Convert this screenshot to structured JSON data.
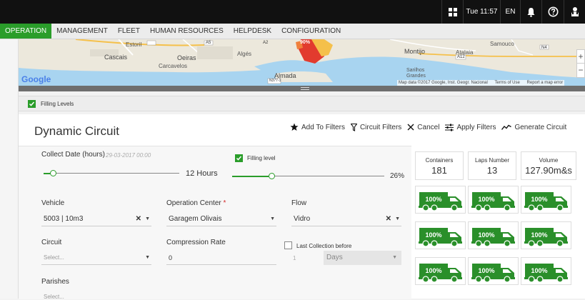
{
  "topbar": {
    "time": "Tue 11:57",
    "lang": "EN"
  },
  "nav": [
    {
      "label": "OPERATION"
    },
    {
      "label": "MANAGEMENT"
    },
    {
      "label": "FLEET"
    },
    {
      "label": "HUMAN RESOURCES"
    },
    {
      "label": "HELPDESK"
    },
    {
      "label": "CONFIGURATION"
    }
  ],
  "map": {
    "places": [
      "Estoril",
      "Cascais",
      "Oeiras",
      "Carcavelos",
      "Algés",
      "Almada",
      "Montijo",
      "Atalaia",
      "Samouco",
      "Sarilhos Grandes"
    ],
    "roads": [
      "A5",
      "A2",
      "A12",
      "N4",
      "N377-1"
    ],
    "google": "Google",
    "attribution": "Map data ©2017 Google, Inst. Geogr. Nacional",
    "terms": "Terms of Use",
    "report": "Report a map error",
    "marker": "90%",
    "zoom_in": "+",
    "zoom_out": "−"
  },
  "filling_bar": {
    "label": "Filling Levels",
    "checked": true
  },
  "main": {
    "title": "Dynamic Circuit",
    "toolbar": {
      "add_filters": "Add To Filters",
      "circuit_filters": "Circuit Filters",
      "cancel": "Cancel",
      "apply_filters": "Apply Filters",
      "generate_circuit": "Generate Circuit"
    },
    "collect_date": {
      "label": "Collect Date (hours)",
      "hint": "29-03-2017 00:00",
      "value": "12 Hours",
      "fraction": 0.08
    },
    "filling_level": {
      "label": "Filling level",
      "value": "26%",
      "fraction": 0.26,
      "checked": true
    },
    "vehicle": {
      "label": "Vehicle",
      "value": "5003 | 10m3"
    },
    "operation_center": {
      "label": "Operation Center",
      "required": "*",
      "value": "Garagem Olivais"
    },
    "flow": {
      "label": "Flow",
      "value": "Vidro"
    },
    "circuit": {
      "label": "Circuit",
      "placeholder": "Select..."
    },
    "compression_rate": {
      "label": "Compression Rate",
      "value": "0"
    },
    "last_collection": {
      "label": "Last Collection before",
      "number": "1",
      "unit": "Days",
      "checked": false
    },
    "parishes": {
      "label": "Parishes",
      "placeholder": "Select..."
    }
  },
  "stats": [
    {
      "title": "Containers",
      "value": "181"
    },
    {
      "title": "Laps Number",
      "value": "13"
    },
    {
      "title": "Volume",
      "value": "127.90m&s"
    }
  ],
  "trucks": [
    "100%",
    "100%",
    "100%",
    "100%",
    "100%",
    "100%",
    "100%",
    "100%",
    "100%"
  ],
  "colors": {
    "accent": "#2a9d2a",
    "topbar": "#111111",
    "marker": "#e23b2e"
  }
}
